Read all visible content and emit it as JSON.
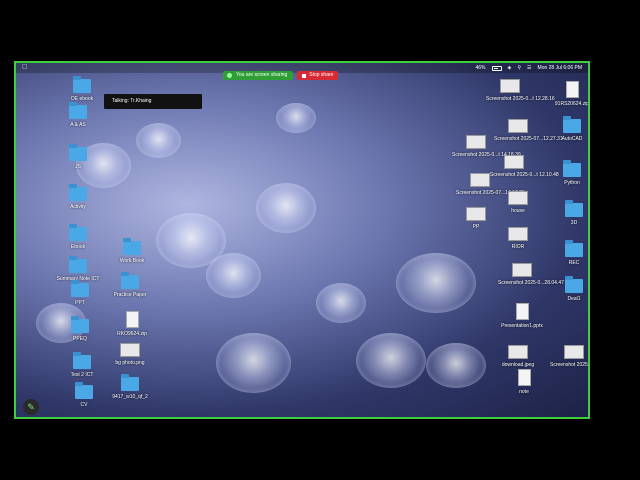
{
  "menubar": {
    "date_time": "Mon 28 Jul  6:06 PM",
    "battery": "46%"
  },
  "share": {
    "status": "You are screen sharing",
    "stop_label": "Stop share"
  },
  "talking": "Talking: Tr.Khaing",
  "icons": [
    {
      "label": "OE ebook",
      "kind": "folder"
    },
    {
      "label": "A & AS",
      "kind": "folder"
    },
    {
      "label": "JS",
      "kind": "folder"
    },
    {
      "label": "Activity",
      "kind": "folder"
    },
    {
      "label": "Ebook",
      "kind": "folder"
    },
    {
      "label": "Summary Note ICT",
      "kind": "folder"
    },
    {
      "label": "PPT",
      "kind": "folder"
    },
    {
      "label": "PPEQ",
      "kind": "folder"
    },
    {
      "label": "Test 2 ICT",
      "kind": "folder"
    },
    {
      "label": "CV",
      "kind": "folder"
    },
    {
      "label": "Work Book",
      "kind": "folder"
    },
    {
      "label": "Practice Paper",
      "kind": "folder"
    },
    {
      "label": "RKO9624.zip",
      "kind": "doc"
    },
    {
      "label": "bg photo.png",
      "kind": "thumb"
    },
    {
      "label": "9417_w10_qf_2",
      "kind": "folder"
    },
    {
      "label": "Screenshot 2025-0...t 12.28.16",
      "kind": "thumb"
    },
    {
      "label": "Screenshot 2025-07...12.27.31",
      "kind": "thumb"
    },
    {
      "label": "Screenshot 2025-0...t 14.18.39",
      "kind": "thumb"
    },
    {
      "label": "Screenshot 2025-0...t 12.10.48",
      "kind": "thumb"
    },
    {
      "label": "Screenshot 2025-07...14.17.25",
      "kind": "thumb"
    },
    {
      "label": "house",
      "kind": "thumb"
    },
    {
      "label": "PP",
      "kind": "thumb"
    },
    {
      "label": "RIOR",
      "kind": "thumb"
    },
    {
      "label": "Screenshot 2025-0...28.04.47",
      "kind": "thumb"
    },
    {
      "label": "Presentation1.pptx",
      "kind": "doc"
    },
    {
      "label": "download.jpeg",
      "kind": "thumb"
    },
    {
      "label": "note",
      "kind": "doc"
    },
    {
      "label": "91RS20624.zip",
      "kind": "doc"
    },
    {
      "label": "AutoCAD",
      "kind": "folder"
    },
    {
      "label": "Python",
      "kind": "folder"
    },
    {
      "label": "3D",
      "kind": "folder"
    },
    {
      "label": "REC",
      "kind": "folder"
    },
    {
      "label": "Deal1",
      "kind": "folder"
    },
    {
      "label": "Screenshot 2025-07...12.31.00",
      "kind": "thumb"
    }
  ]
}
